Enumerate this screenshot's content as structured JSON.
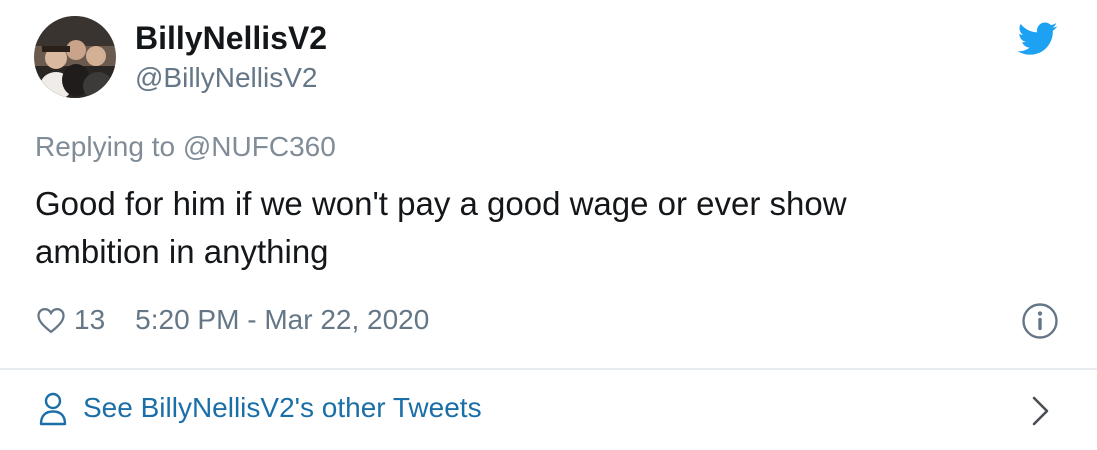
{
  "tweet": {
    "author": {
      "display_name": "BillyNellisV2",
      "handle": "@BillyNellisV2"
    },
    "replying_prefix": "Replying to",
    "replying_to": "@NUFC360",
    "text": "Good for him if we won't pay a good wage or ever show ambition in anything",
    "likes": "13",
    "timestamp": "5:20 PM - Mar 22, 2020"
  },
  "footer": {
    "other_tweets_label": "See BillyNellisV2's other Tweets"
  },
  "icons": {
    "brand": "twitter-bird-icon",
    "like": "heart-outline-icon",
    "info": "info-circle-icon",
    "profile": "person-icon",
    "more": "chevron-right-icon"
  },
  "colors": {
    "twitter_blue": "#1da1f2",
    "link_blue": "#1b6fa8",
    "text_primary": "#14171a",
    "text_secondary": "#657786",
    "divider": "#e6ecf0"
  }
}
